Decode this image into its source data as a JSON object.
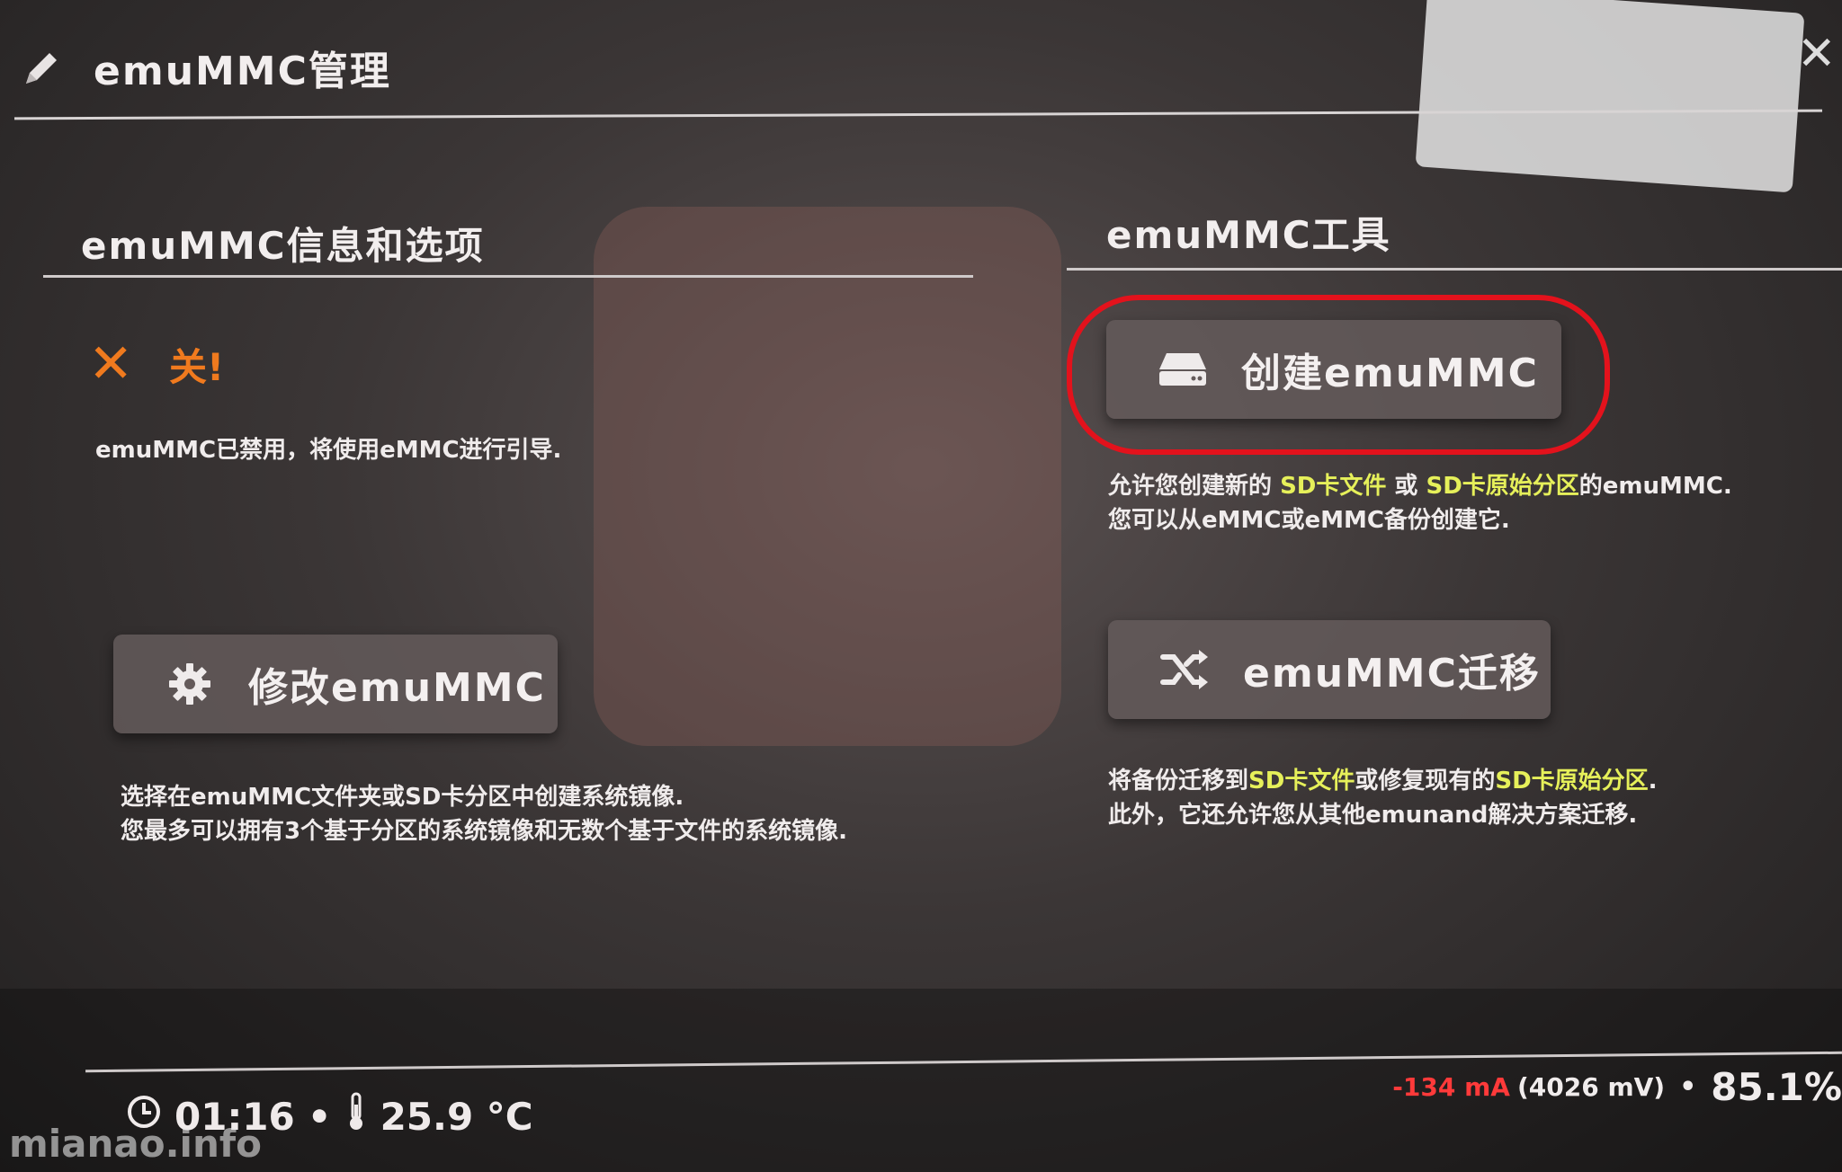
{
  "header": {
    "title": "emuMMC管理",
    "icon": "pencil-icon",
    "close_icon": "close-icon"
  },
  "left": {
    "section_title": "emuMMC信息和选项",
    "status_text": "关!",
    "status_color": "#f07a1e",
    "status_desc": "emuMMC已禁用，将使用eMMC进行引导.",
    "modify_button": "修改emuMMC",
    "modify_desc_line1": "选择在emuMMC文件夹或SD卡分区中创建系统镜像.",
    "modify_desc_line2": "您最多可以拥有3个基于分区的系统镜像和无数个基于文件的系统镜像."
  },
  "right": {
    "section_title": "emuMMC工具",
    "create_button": "创建emuMMC",
    "create_desc": {
      "p1": "允许您创建新的 ",
      "h1": "SD卡文件",
      "p2": " 或 ",
      "h2": "SD卡原始分区",
      "p3": "的emuMMC.",
      "line2": "您可以从eMMC或eMMC备份创建它."
    },
    "migrate_button": "emuMMC迁移",
    "migrate_desc": {
      "p1": "将备份迁移到",
      "h1": "SD卡文件",
      "p2": "或修复现有的",
      "h2": "SD卡原始分区",
      "p3": ".",
      "line2": "此外，它还允许您从其他emunand解决方案迁移."
    }
  },
  "footer": {
    "time": "01:16",
    "separator": "•",
    "temperature": "25.9 °C",
    "current": "-134 mA",
    "voltage": "(4026 mV)",
    "battery": "85.1%"
  },
  "watermark": "mianao.info",
  "colors": {
    "highlight": "#e6f05a",
    "annotation_ring": "#e3121c",
    "current": "#ff3a3a"
  }
}
